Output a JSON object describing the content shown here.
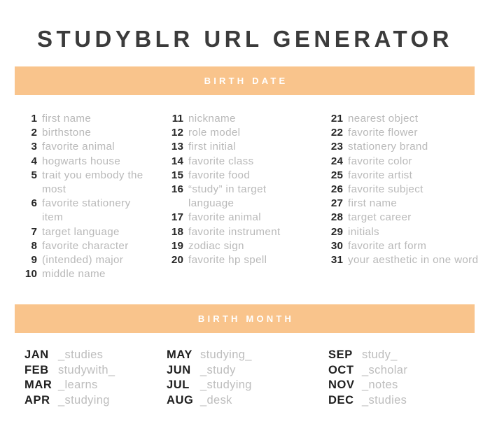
{
  "page": {
    "title": "STUDYBLR URL GENERATOR",
    "background_color": "#ffffff",
    "title_color": "#3b3b3b",
    "banner_color": "#f9c48c",
    "banner_text_color": "#ffffff",
    "number_color": "#262626",
    "label_color": "#b9b9b9"
  },
  "sections": {
    "birth_date": {
      "banner_label": "BIRTH DATE",
      "columns": [
        {
          "items": [
            {
              "num": "1",
              "label": "first name"
            },
            {
              "num": "2",
              "label": "birthstone"
            },
            {
              "num": "3",
              "label": "favorite animal"
            },
            {
              "num": "4",
              "label": "hogwarts house"
            },
            {
              "num": "5",
              "label": "trait you embody the most"
            },
            {
              "num": "6",
              "label": "favorite stationery item"
            },
            {
              "num": "7",
              "label": "target language"
            },
            {
              "num": "8",
              "label": "favorite character"
            },
            {
              "num": "9",
              "label": "(intended) major"
            },
            {
              "num": "10",
              "label": "middle name"
            }
          ]
        },
        {
          "items": [
            {
              "num": "11",
              "label": "nickname"
            },
            {
              "num": "12",
              "label": "role model"
            },
            {
              "num": "13",
              "label": "first initial"
            },
            {
              "num": "14",
              "label": "favorite class"
            },
            {
              "num": "15",
              "label": "favorite food"
            },
            {
              "num": "16",
              "label": "“study” in target language"
            },
            {
              "num": "17",
              "label": "favorite animal"
            },
            {
              "num": "18",
              "label": "favorite instrument"
            },
            {
              "num": "19",
              "label": "zodiac sign"
            },
            {
              "num": "20",
              "label": "favorite hp spell"
            }
          ]
        },
        {
          "items": [
            {
              "num": "21",
              "label": "nearest object"
            },
            {
              "num": "22",
              "label": "favorite flower"
            },
            {
              "num": "23",
              "label": "stationery brand"
            },
            {
              "num": "24",
              "label": "favorite color"
            },
            {
              "num": "25",
              "label": "favorite artist"
            },
            {
              "num": "26",
              "label": "favorite subject"
            },
            {
              "num": "27",
              "label": "first name"
            },
            {
              "num": "28",
              "label": "target career"
            },
            {
              "num": "29",
              "label": "initials"
            },
            {
              "num": "30",
              "label": "favorite art form"
            },
            {
              "num": "31",
              "label": "your aesthetic in one word"
            }
          ]
        }
      ]
    },
    "birth_month": {
      "banner_label": "BIRTH MONTH",
      "columns": [
        {
          "items": [
            {
              "abbr": "JAN",
              "suffix": "_studies"
            },
            {
              "abbr": "FEB",
              "suffix": "studywith_"
            },
            {
              "abbr": "MAR",
              "suffix": "_learns"
            },
            {
              "abbr": "APR",
              "suffix": "_studying"
            }
          ]
        },
        {
          "items": [
            {
              "abbr": "MAY",
              "suffix": "studying_"
            },
            {
              "abbr": "JUN",
              "suffix": "_study"
            },
            {
              "abbr": "JUL",
              "suffix": "_studying"
            },
            {
              "abbr": "AUG",
              "suffix": "_desk"
            }
          ]
        },
        {
          "items": [
            {
              "abbr": "SEP",
              "suffix": "study_"
            },
            {
              "abbr": "OCT",
              "suffix": "_scholar"
            },
            {
              "abbr": "NOV",
              "suffix": "_notes"
            },
            {
              "abbr": "DEC",
              "suffix": "_studies"
            }
          ]
        }
      ]
    }
  }
}
